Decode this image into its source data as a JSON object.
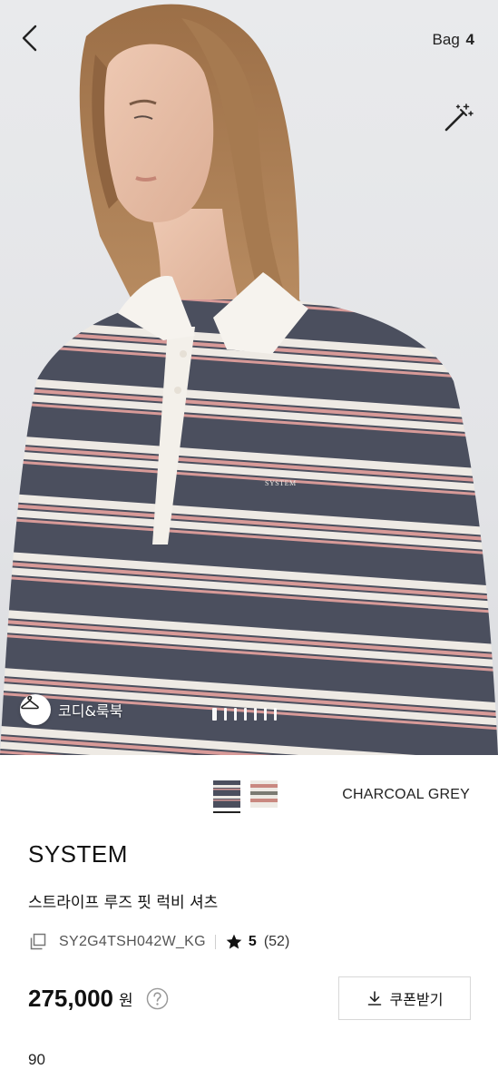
{
  "header": {
    "bag_label": "Bag",
    "bag_count": "4"
  },
  "hero": {
    "lookbook_label": "코디&룩북",
    "shirt_logo": "SYSTEM",
    "page_indicator_count": 7
  },
  "colors": {
    "selected_name": "CHARCOAL GREY",
    "swatches": [
      "charcoal-grey",
      "second-color"
    ]
  },
  "product": {
    "brand": "SYSTEM",
    "name": "스트라이프 루즈 핏 럭비 셔츠",
    "sku": "SY2G4TSH042W_KG",
    "rating": "5",
    "review_count": "(52)",
    "price": "275,000",
    "currency": "원"
  },
  "coupon": {
    "label": "쿠폰받기"
  },
  "size": {
    "value": "90"
  },
  "icons": {
    "back": "chevron-left-icon",
    "magic": "magic-wand-icon",
    "lookbook": "hanger-icon",
    "copy": "copy-icon",
    "star": "star-icon",
    "help": "question-icon",
    "download": "download-icon"
  },
  "palette": {
    "charcoal": "#4b4f5e",
    "stripe_white": "#eeeae4",
    "stripe_pink": "#d89a98",
    "background": "#e6e7ea"
  }
}
